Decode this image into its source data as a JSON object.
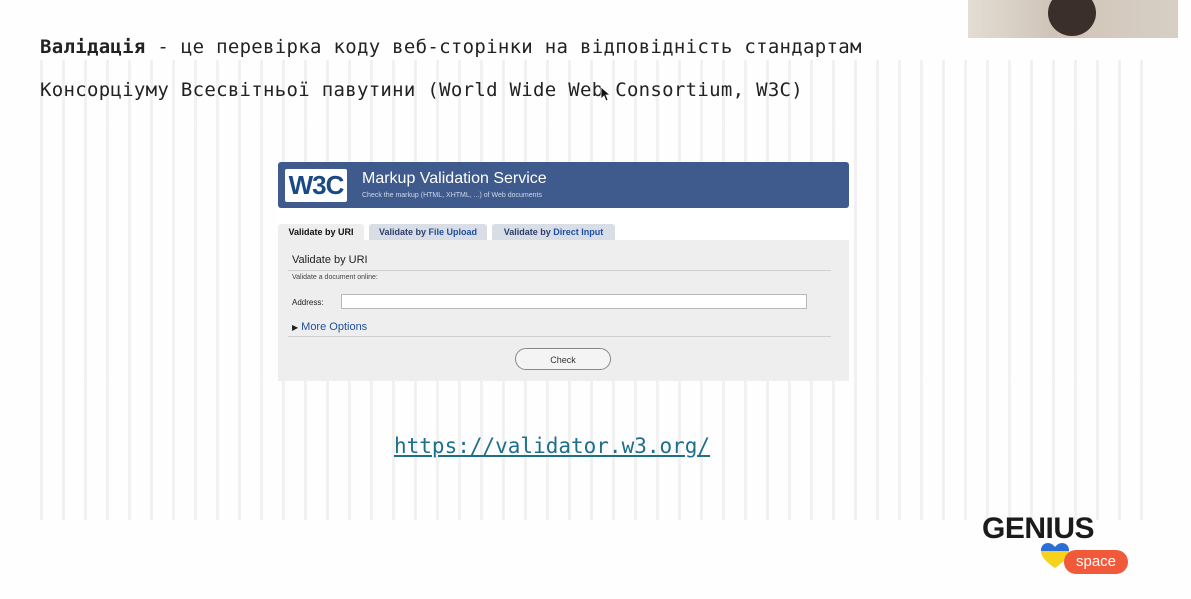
{
  "slide": {
    "term": "Валідація",
    "line1_rest": " - це перевірка коду веб-сторінки на відповідність стандартам",
    "line2": "Консорціуму Всесвітньої павутини (World Wide Web Consortium, W3C)",
    "url": "https://validator.w3.org/"
  },
  "w3c": {
    "logo_text": "W3C",
    "title": "Markup Validation Service",
    "subtitle": "Check the markup (HTML, XHTML, ...) of Web documents",
    "tabs": [
      {
        "prefix": "Validate by ",
        "highlight": "URI"
      },
      {
        "prefix": "Validate by ",
        "highlight": "File Upload"
      },
      {
        "prefix": "Validate by ",
        "highlight": "Direct Input"
      }
    ],
    "panel_title": "Validate by URI",
    "panel_sub": "Validate a document online:",
    "address_label": "Address:",
    "address_value": "",
    "more_options": "More Options",
    "check_button": "Check"
  },
  "brand": {
    "wordmark": "GENIUS",
    "pill": "space",
    "heart_colors": [
      "#2b6fd6",
      "#f7d21c"
    ],
    "pill_color": "#f05a3a"
  }
}
